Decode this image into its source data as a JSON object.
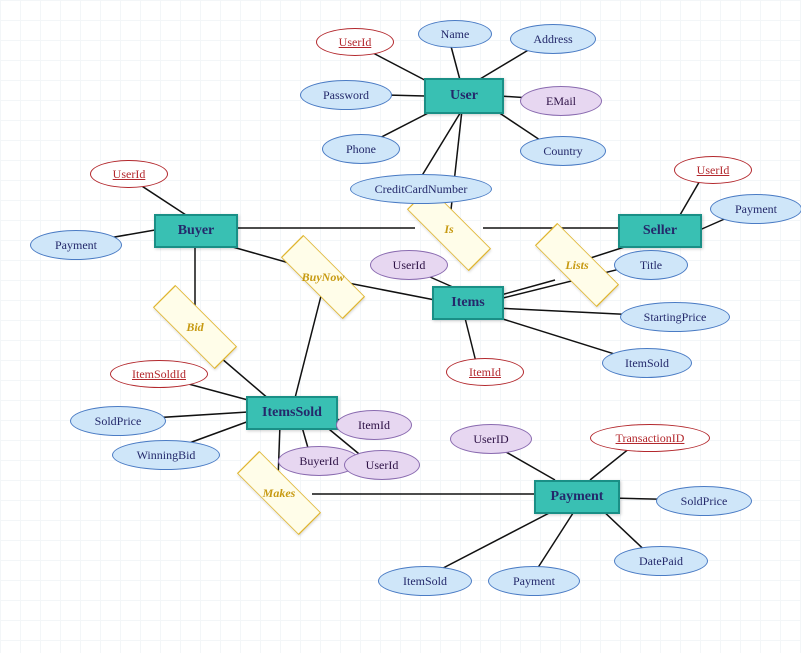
{
  "entities": {
    "user": "User",
    "buyer": "Buyer",
    "seller": "Seller",
    "items": "Items",
    "itemsSold": "ItemsSold",
    "payment": "Payment"
  },
  "relationships": {
    "is": "Is",
    "lists": "Lists",
    "buyNow": "BuyNow",
    "bid": "Bid",
    "makes": "Makes"
  },
  "attrs": {
    "user": {
      "userId": "UserId",
      "name": "Name",
      "address": "Address",
      "password": "Password",
      "email": "EMail",
      "phone": "Phone",
      "country": "Country",
      "ccn": "CreditCardNumber"
    },
    "buyer": {
      "userId": "UserId",
      "payment": "Payment"
    },
    "seller": {
      "userId": "UserId",
      "payment": "Payment"
    },
    "items": {
      "userId": "UserId",
      "itemId": "ItemId",
      "title": "Title",
      "startingPrice": "StartingPrice",
      "itemSold": "ItemSold"
    },
    "itemsSold": {
      "itemSoldId": "ItemSoldId",
      "soldPrice": "SoldPrice",
      "winningBid": "WinningBid",
      "buyerId": "BuyerId",
      "itemId": "ItemId",
      "userId": "UserId"
    },
    "payment": {
      "userId": "UserID",
      "transactionId": "TransactionID",
      "soldPrice": "SoldPrice",
      "datePaid": "DatePaid",
      "payment": "Payment",
      "itemSold": "ItemSold"
    }
  }
}
